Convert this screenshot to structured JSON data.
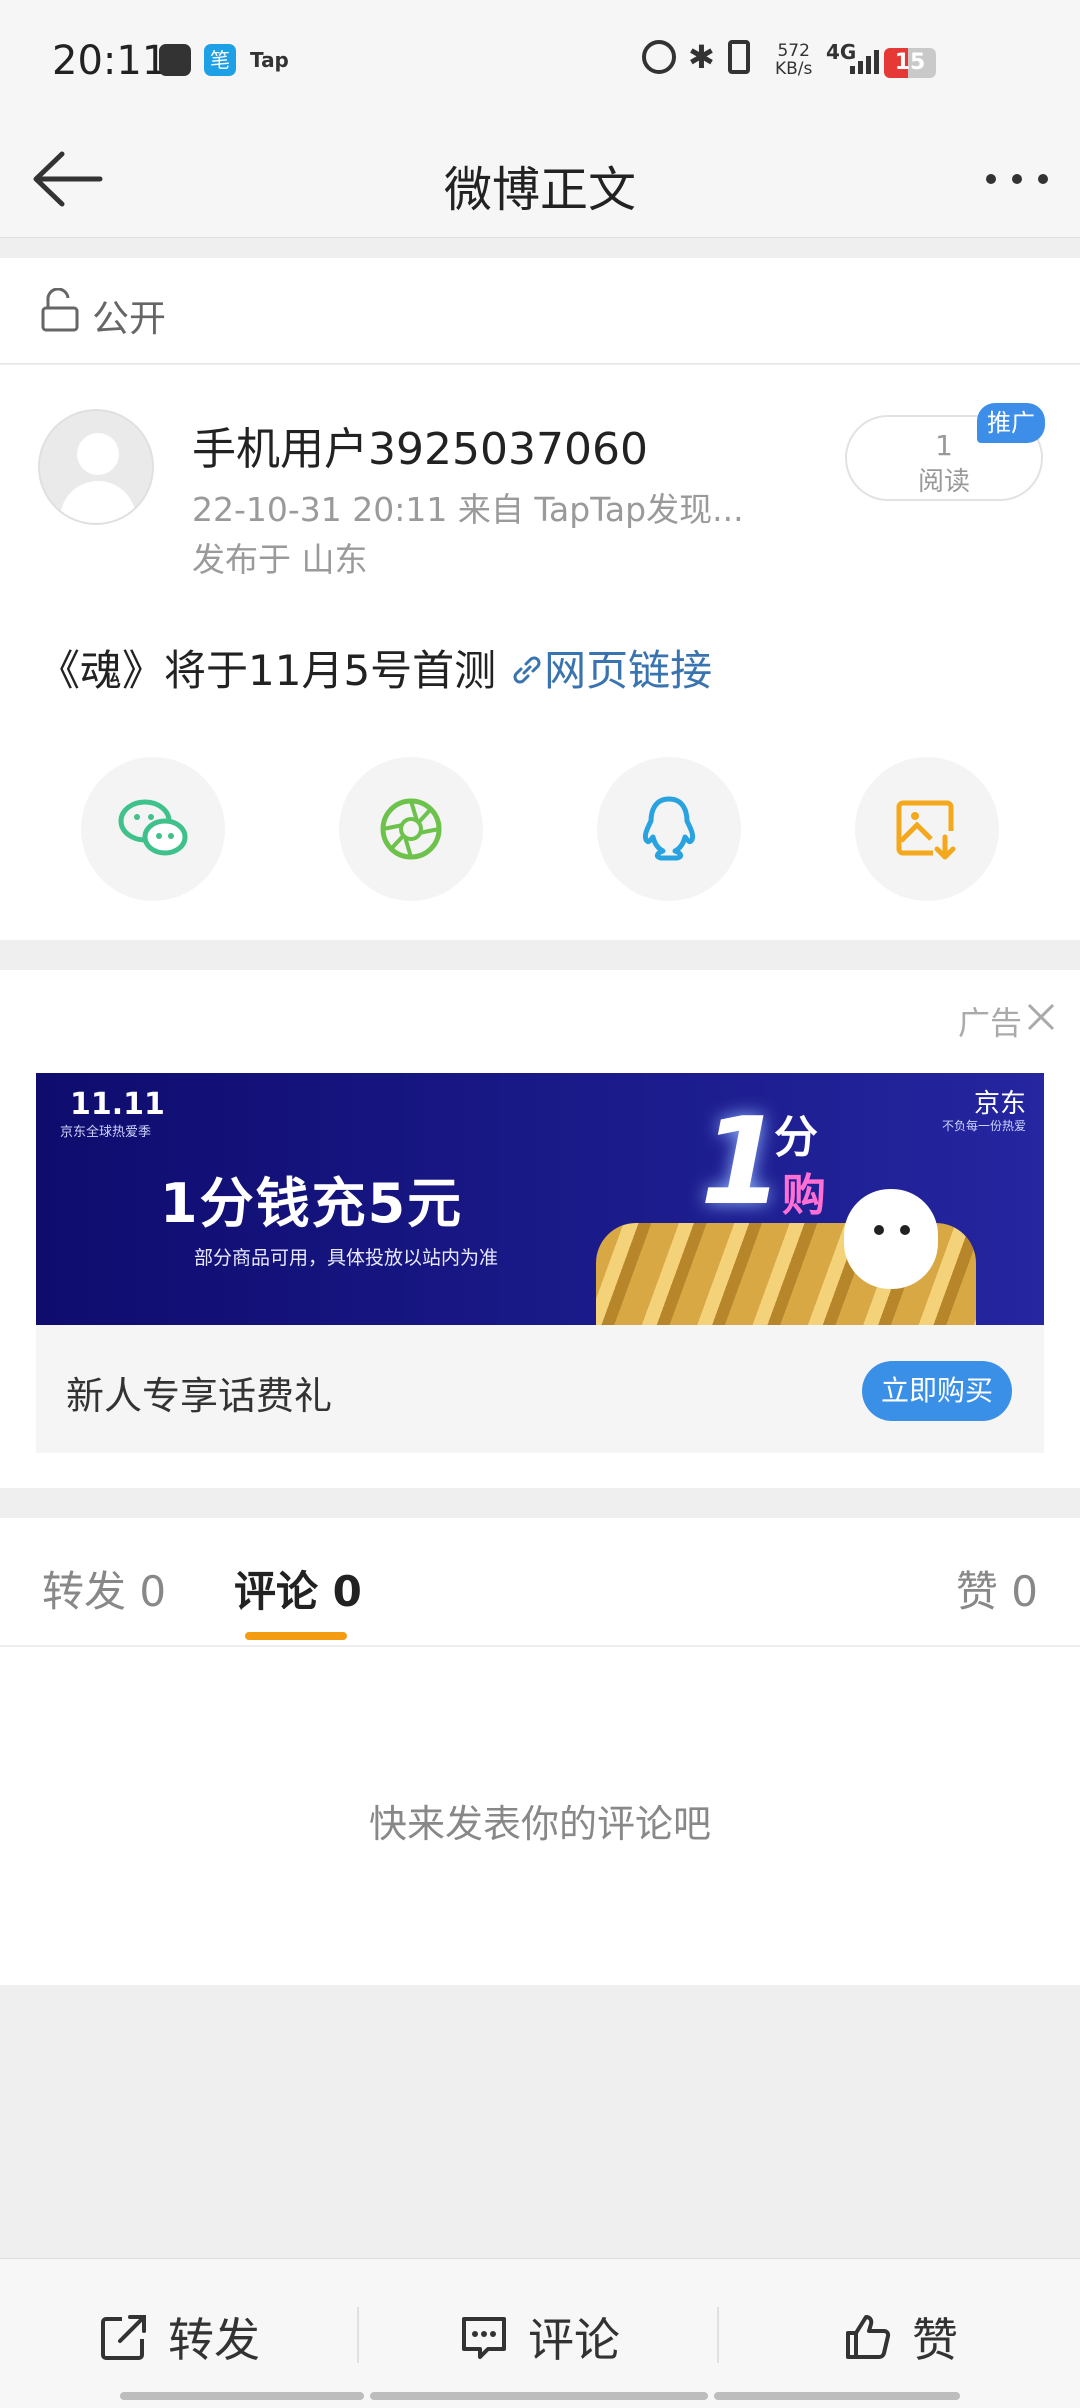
{
  "status_bar": {
    "time": "20:11",
    "app_icon_2": "笔",
    "tap_label": "Tap",
    "speed_value": "572",
    "speed_unit": "KB/s",
    "network": "4G",
    "battery_level": 15,
    "battery_text": "15",
    "battery_color": "#e53935"
  },
  "header": {
    "title": "微博正文"
  },
  "visibility": {
    "label": "公开"
  },
  "post": {
    "username": "手机用户3925037060",
    "meta": "22-10-31 20:11   来自 TapTap发现...",
    "location": "发布于 山东",
    "read_count": "1",
    "read_label": "阅读",
    "promo_tag": "推广",
    "text": "《魂》将于11月5号首测",
    "link_text": "网页链接",
    "link_color": "#3a74b0",
    "share_icons": [
      "wechat-icon",
      "moments-icon",
      "qq-icon",
      "save-image-icon"
    ]
  },
  "ad": {
    "label": "广告",
    "banner_logo": "11.11",
    "banner_logo_sub": "京东全球热爱季",
    "banner_headline": "1分钱充5元",
    "banner_subtext": "部分商品可用，具体投放以站内为准",
    "banner_brand": "京东",
    "banner_brand_sub": "不负每一份热爱",
    "banner_big": "1",
    "banner_fen": "分",
    "banner_gou": "购",
    "caption": "新人专享话费礼",
    "button": "立即购买",
    "button_color": "#3a8fe6"
  },
  "tabs": {
    "repost": "转发 0",
    "comment": "评论 0",
    "like": "赞 0",
    "active_color": "#f39c12"
  },
  "comments": {
    "empty_text": "快来发表你的评论吧"
  },
  "bottom_bar": {
    "repost": "转发",
    "comment": "评论",
    "like": "赞"
  }
}
